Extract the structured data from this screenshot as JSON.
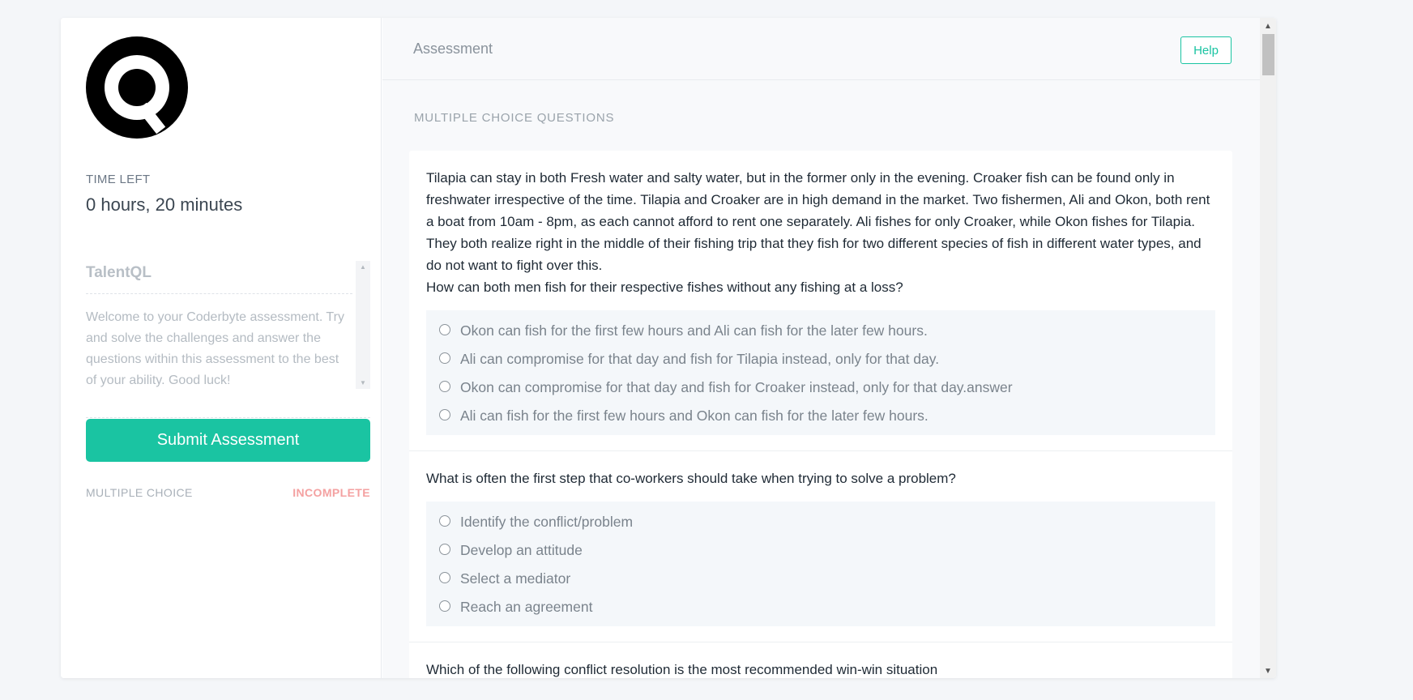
{
  "sidebar": {
    "logo": "talentql-logo",
    "time_label": "TIME LEFT",
    "time_value": "0 hours, 20 minutes",
    "intro_title": "TalentQL",
    "intro_text": "Welcome to your Coderbyte assessment. Try and solve the challenges and answer the questions within this assessment to the best of your ability. Good luck!",
    "submit_label": "Submit Assessment",
    "section_name": "MULTIPLE CHOICE",
    "section_status": "INCOMPLETE"
  },
  "header": {
    "title": "Assessment",
    "help_label": "Help"
  },
  "main": {
    "section_heading": "MULTIPLE CHOICE QUESTIONS",
    "questions": [
      {
        "text": "Tilapia can stay in both Fresh water and salty water, but in the former only in the evening. Croaker fish can be found only in freshwater irrespective of the time. Tilapia and Croaker are in high demand in the market. Two fishermen, Ali and Okon, both rent a boat from 10am - 8pm, as each cannot afford to rent one separately. Ali fishes for only Croaker, while Okon fishes for Tilapia. They both realize right in the middle of their fishing trip that they fish for two different species of fish in different water types, and do not want to fight over this.\nHow can both men fish for their respective fishes without any fishing at a loss?",
        "options": [
          "Okon can fish for the first few hours and Ali can fish for the later few hours.",
          "Ali can compromise for that day and fish for Tilapia instead, only for that day.",
          "Okon can compromise for that day and fish for Croaker instead, only for that day.answer",
          "Ali can fish for the first few hours and Okon can fish for the later few hours."
        ]
      },
      {
        "text": "What is often the first step that co-workers should take when trying to solve a problem?",
        "options": [
          "Identify the conflict/problem",
          "Develop an attitude",
          "Select a mediator",
          "Reach an agreement"
        ]
      },
      {
        "text": "Which of the following conflict resolution is the most recommended win-win situation",
        "options": []
      }
    ]
  },
  "colors": {
    "accent": "#1ac4a2",
    "status_incomplete": "#f4a1a1"
  }
}
